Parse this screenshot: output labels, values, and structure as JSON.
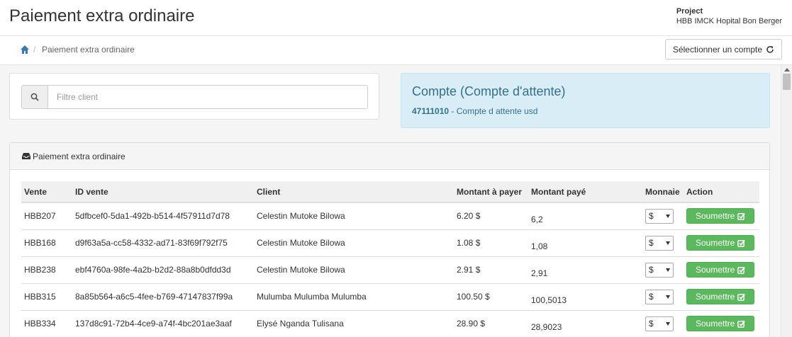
{
  "header": {
    "title": "Paiement extra ordinaire",
    "project_label": "Project",
    "project_name": "HBB IMCK Hopital Bon Berger"
  },
  "breadcrumb": {
    "current": "Paiement extra ordinaire",
    "separator": "/"
  },
  "account_button_label": "Sélectionner un compte",
  "filter": {
    "placeholder": "Filtre client",
    "value": ""
  },
  "account": {
    "heading": "Compte (Compte d'attente)",
    "number": "47111010",
    "description": " - Compte d attente usd"
  },
  "panel_title": "Paiement extra ordinaire",
  "table": {
    "headers": [
      "Vente",
      "ID vente",
      "Client",
      "Montant à payer",
      "Montant payé",
      "Monnaie",
      "Action"
    ],
    "rows": [
      {
        "vente": "HBB207",
        "id": "5dfbcef0-5da1-492b-b514-4f57911d7d78",
        "client": "Celestin Mutoke Bilowa",
        "montant": "6.20 $",
        "paye": "6,2",
        "monnaie": "$",
        "action": "Soumettre"
      },
      {
        "vente": "HBB168",
        "id": "d9f63a5a-cc58-4332-ad71-83f69f792f75",
        "client": "Celestin Mutoke Bilowa",
        "montant": "1.08 $",
        "paye": "1,08",
        "monnaie": "$",
        "action": "Soumettre"
      },
      {
        "vente": "HBB238",
        "id": "ebf4760a-98fe-4a2b-b2d2-88a8b0dfdd3d",
        "client": "Celestin Mutoke Bilowa",
        "montant": "2.91 $",
        "paye": "2,91",
        "monnaie": "$",
        "action": "Soumettre"
      },
      {
        "vente": "HBB315",
        "id": "8a85b564-a6c5-4fee-b769-47147837f99a",
        "client": "Mulumba Mulumba Mulumba",
        "montant": "100.50 $",
        "paye": "100,5013",
        "monnaie": "$",
        "action": "Soumettre"
      },
      {
        "vente": "HBB334",
        "id": "137d8c91-72b4-4ce9-a74f-4bc201ae3aaf",
        "client": "Elysé Nganda Tulisana",
        "montant": "28.90 $",
        "paye": "28,9023",
        "monnaie": "$",
        "action": "Soumettre"
      }
    ]
  },
  "colors": {
    "primary_link": "#337ab7",
    "info_bg": "#d9edf7",
    "info_text": "#31708f",
    "success": "#5cb85c"
  }
}
